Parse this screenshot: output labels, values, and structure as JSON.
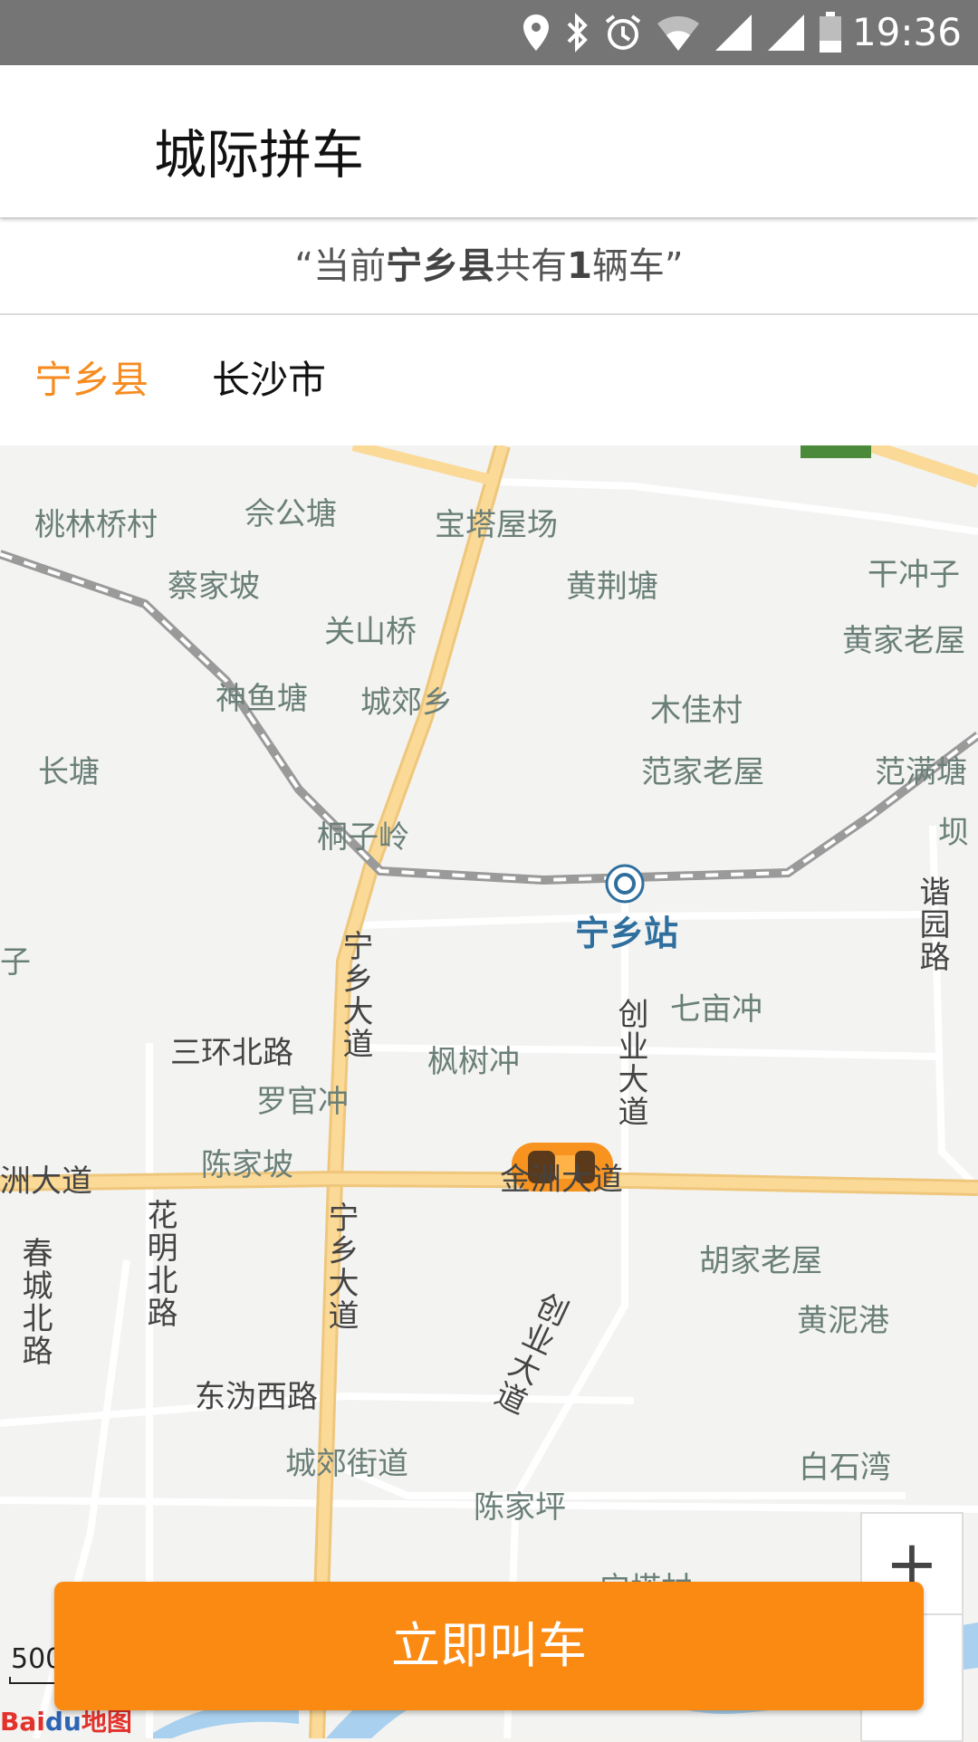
{
  "status_bar": {
    "time": "19:36",
    "icons": [
      "location-icon",
      "bluetooth-icon",
      "alarm-icon",
      "wifi-icon",
      "signal-icon",
      "signal-icon",
      "battery-icon"
    ]
  },
  "app_bar": {
    "title": "城际拼车"
  },
  "notice": {
    "prefix": "“当前",
    "county": "宁乡县",
    "middle": "共有",
    "count": "1",
    "suffix": "辆车”"
  },
  "tabs": [
    {
      "label": "宁乡县",
      "active": true
    },
    {
      "label": "长沙市",
      "active": false
    }
  ],
  "map": {
    "places": [
      "桃林桥村",
      "佘公塘",
      "宝塔屋场",
      "蔡家坡",
      "黄荆塘",
      "干冲子",
      "关山桥",
      "黄家老屋",
      "神鱼塘",
      "城郊乡",
      "木佳村",
      "长塘",
      "范家老屋",
      "范满塘",
      "坝",
      "桐子岭",
      "七亩冲",
      "枫树冲",
      "罗官冲",
      "陈家坡",
      "胡家老屋",
      "黄泥港",
      "城郊街道",
      "白石湾",
      "陈家坪",
      "宁塔村"
    ],
    "roads": [
      "宁乡大道",
      "三环北路",
      "创业大道",
      "金洲大道",
      "洲大道",
      "花明北路",
      "春城北路",
      "东沩西路",
      "谐园路",
      "宁乡大道",
      "创业大道",
      "子"
    ],
    "station": "宁乡站",
    "scale": "500",
    "logo_text": "Bai",
    "logo_paw": "du",
    "logo_suffix": "地图",
    "zoom_in": "+"
  },
  "call_button": {
    "label": "立即叫车"
  },
  "colors": {
    "accent": "#fb8a13",
    "tab_active": "#f68b1f",
    "river": "#a9d0ef",
    "main_road": "#fbd997"
  }
}
